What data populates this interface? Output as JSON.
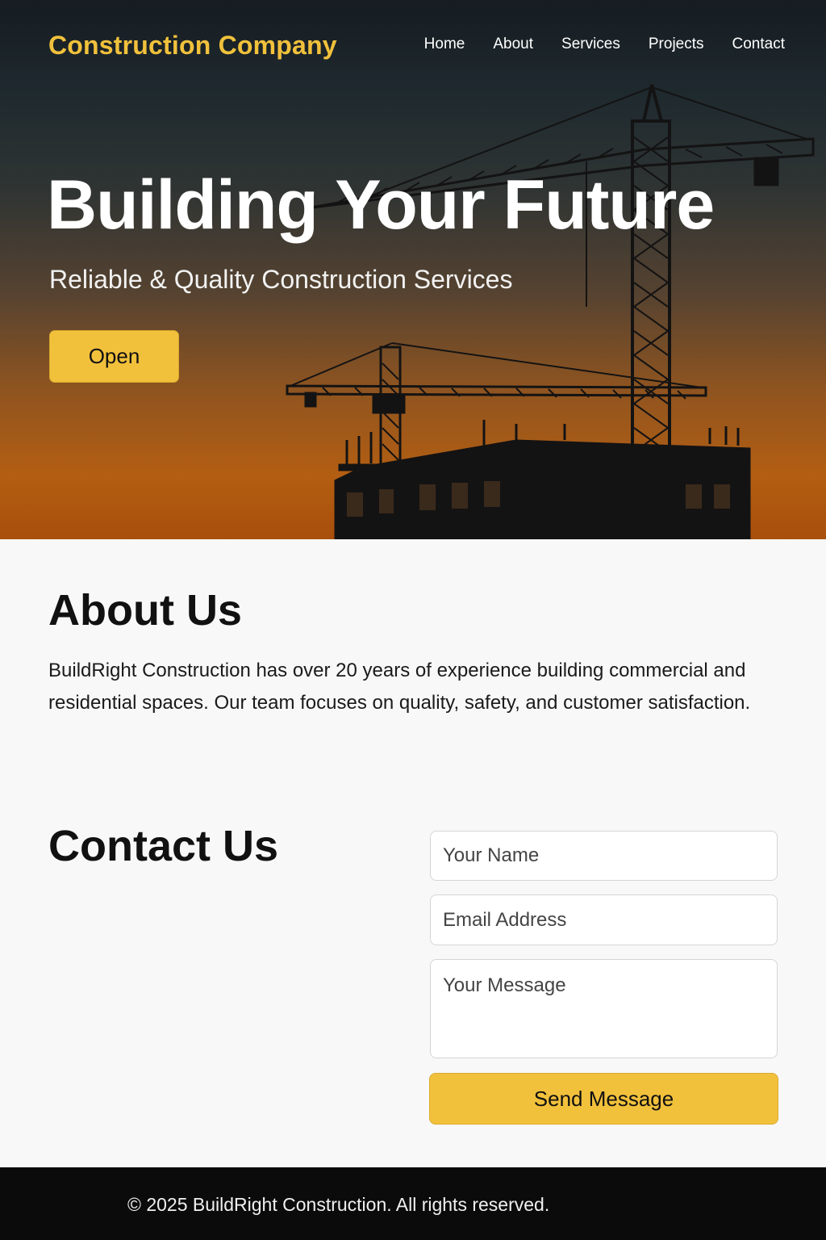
{
  "nav": {
    "brand": "Construction Company",
    "links": [
      "Home",
      "About",
      "Services",
      "Projects",
      "Contact"
    ]
  },
  "hero": {
    "title": "Building Your Future",
    "subtitle": "Reliable & Quality Construction Services",
    "button_label": "Open"
  },
  "about": {
    "heading": "About Us",
    "text": "BuildRight Construction has over 20 years of experience building commercial and residential spaces. Our team focuses on quality, safety, and customer satisfaction."
  },
  "contact": {
    "heading": "Contact Us",
    "name_placeholder": "Your Name",
    "email_placeholder": "Email Address",
    "message_placeholder": "Your Message",
    "submit_label": "Send Message"
  },
  "footer": {
    "text": "© 2025 BuildRight Construction. All rights reserved."
  },
  "colors": {
    "accent": "#f2c13c",
    "footer_bg": "#0b0b0c",
    "page_bg": "#f8f8f8"
  }
}
